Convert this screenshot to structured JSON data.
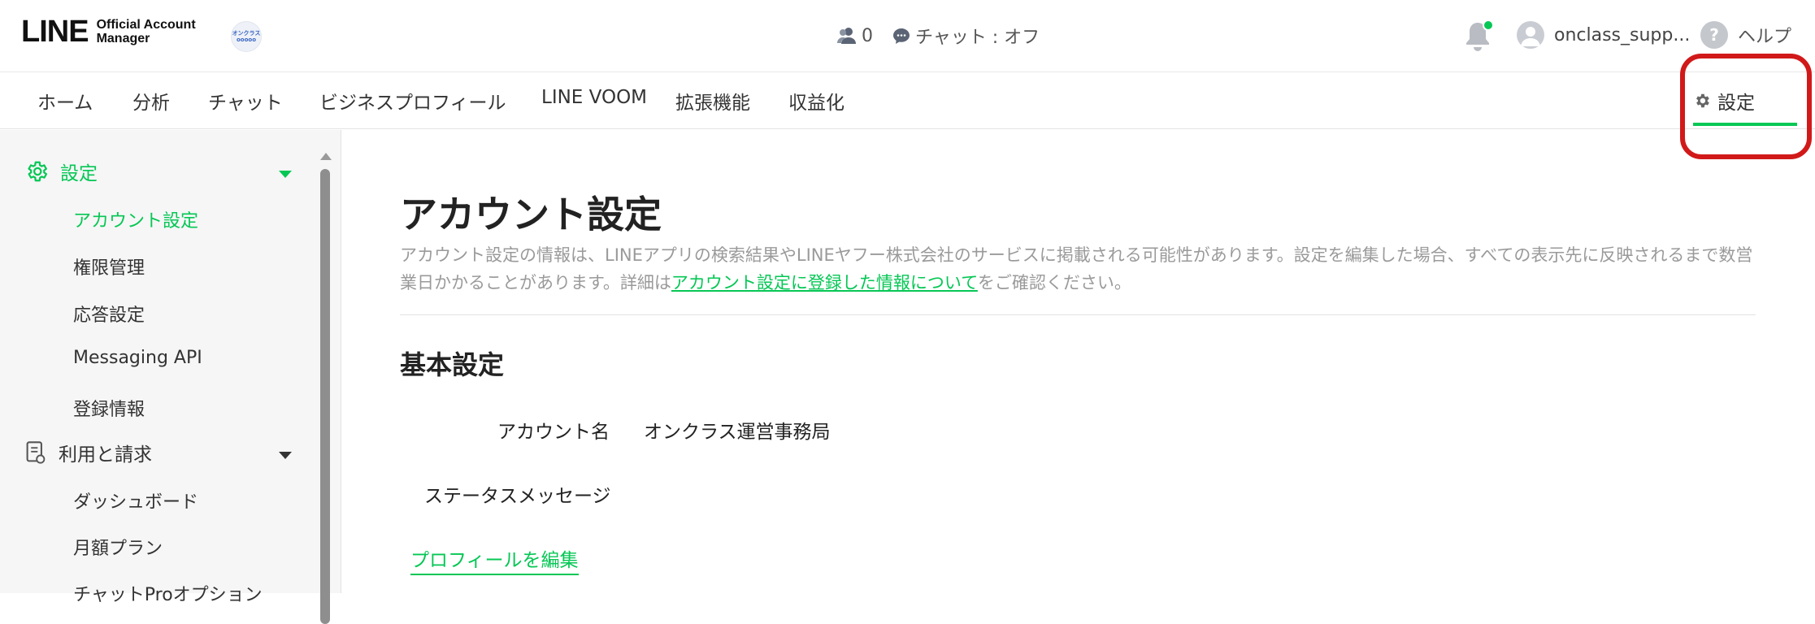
{
  "header": {
    "logo_text": "LINE",
    "logo_sub_1": "Official Account",
    "logo_sub_2": "Manager",
    "account_badge": "オンクラス ooooo",
    "followers_count": "0",
    "chat_status": "チャット : オフ",
    "username": "onclass_supp...",
    "help_label": "ヘルプ",
    "help_icon_text": "?"
  },
  "nav": {
    "items": [
      "ホーム",
      "分析",
      "チャット",
      "ビジネスプロフィール",
      "LINE VOOM",
      "拡張機能",
      "収益化"
    ],
    "settings_label": "設定"
  },
  "sidebar": {
    "group_settings": "設定",
    "settings_items": [
      "アカウント設定",
      "権限管理",
      "応答設定",
      "Messaging API",
      "登録情報"
    ],
    "group_billing": "利用と請求",
    "billing_items": [
      "ダッシュボード",
      "月額プラン",
      "チャットProオプション"
    ]
  },
  "main": {
    "title": "アカウント設定",
    "desc_pre": "アカウント設定の情報は、LINEアプリの検索結果やLINEヤフー株式会社のサービスに掲載される可能性があります。設定を編集した場合、すべての表示先に反映されるまで数営業日かかることがあります。詳細は",
    "desc_link": "アカウント設定に登録した情報について",
    "desc_post": "をご確認ください。",
    "section_title": "基本設定",
    "account_name_label": "アカウント名",
    "account_name_value": "オンクラス運営事務局",
    "status_message_label": "ステータスメッセージ",
    "edit_profile_link": "プロフィールを編集"
  },
  "colors": {
    "brand_green": "#06c755",
    "highlight_red": "#d11919"
  }
}
